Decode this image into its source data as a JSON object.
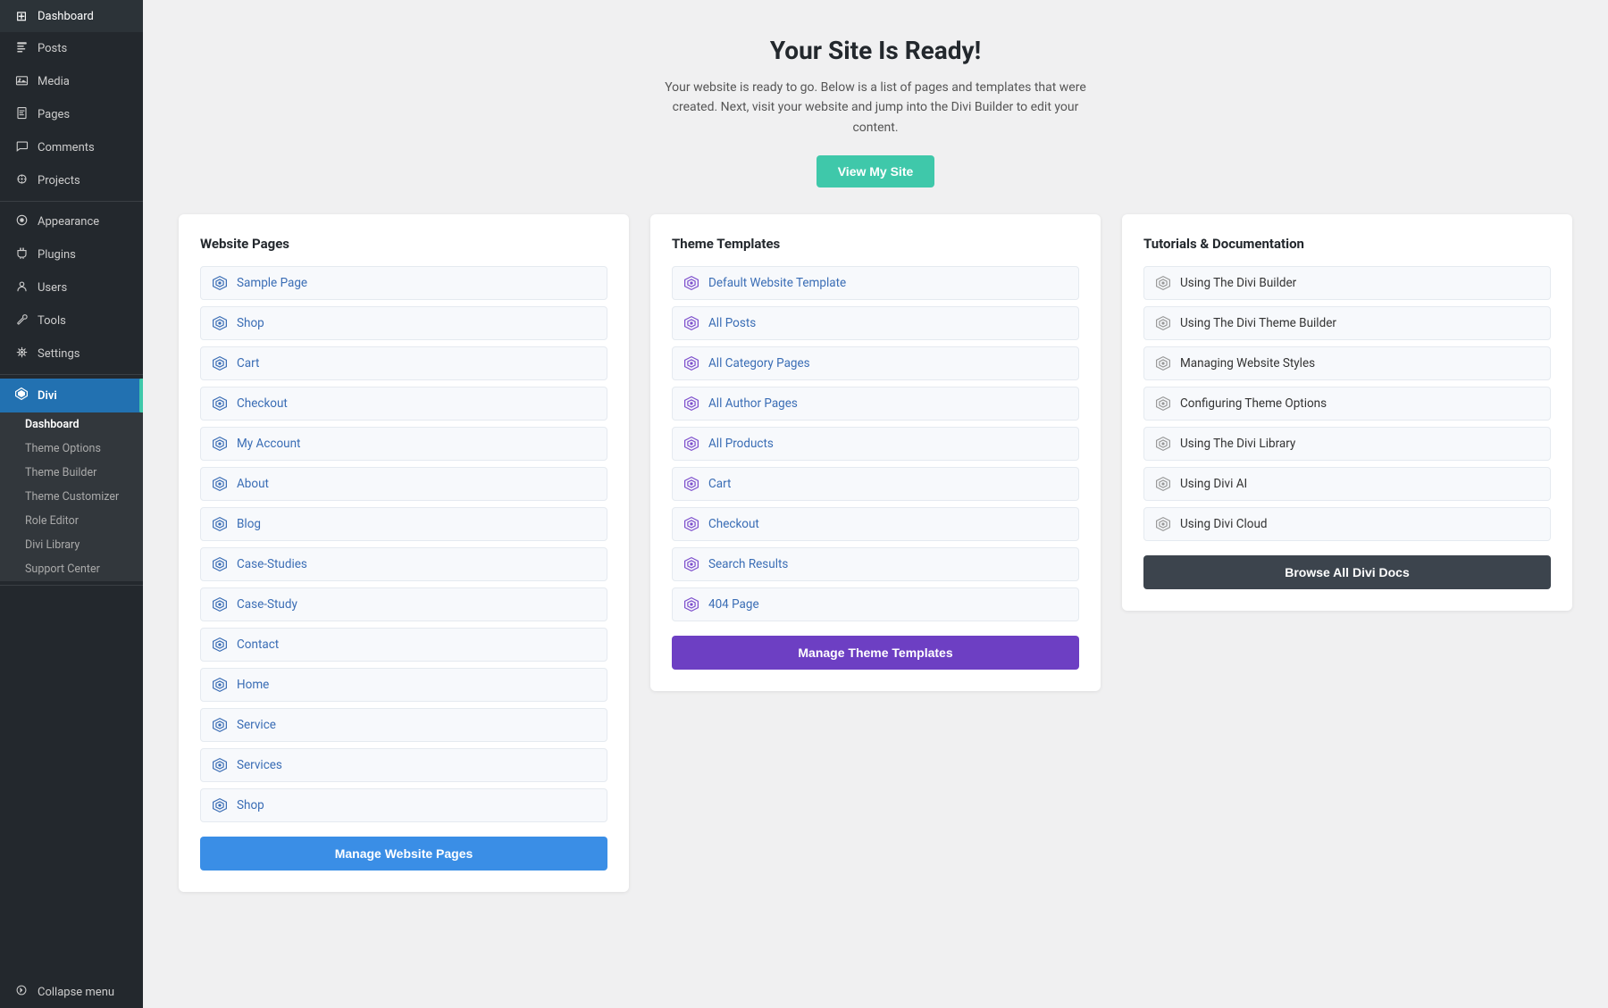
{
  "sidebar": {
    "items": [
      {
        "id": "dashboard",
        "label": "Dashboard",
        "icon": "⊞"
      },
      {
        "id": "posts",
        "label": "Posts",
        "icon": "📄"
      },
      {
        "id": "media",
        "label": "Media",
        "icon": "🖼"
      },
      {
        "id": "pages",
        "label": "Pages",
        "icon": "📋"
      },
      {
        "id": "comments",
        "label": "Comments",
        "icon": "💬"
      },
      {
        "id": "projects",
        "label": "Projects",
        "icon": "📌"
      },
      {
        "id": "appearance",
        "label": "Appearance",
        "icon": "🎨"
      },
      {
        "id": "plugins",
        "label": "Plugins",
        "icon": "🔌"
      },
      {
        "id": "users",
        "label": "Users",
        "icon": "👤"
      },
      {
        "id": "tools",
        "label": "Tools",
        "icon": "🔧"
      },
      {
        "id": "settings",
        "label": "Settings",
        "icon": "⚙"
      }
    ],
    "divi_label": "Divi",
    "divi_sub": [
      {
        "id": "dashboard-sub",
        "label": "Dashboard"
      },
      {
        "id": "theme-options",
        "label": "Theme Options"
      },
      {
        "id": "theme-builder",
        "label": "Theme Builder"
      },
      {
        "id": "theme-customizer",
        "label": "Theme Customizer"
      },
      {
        "id": "role-editor",
        "label": "Role Editor"
      },
      {
        "id": "divi-library",
        "label": "Divi Library"
      },
      {
        "id": "support-center",
        "label": "Support Center"
      }
    ],
    "collapse_label": "Collapse menu"
  },
  "header": {
    "title": "Your Site Is Ready!",
    "description": "Your website is ready to go. Below is a list of pages and templates that were created. Next, visit your website and jump into the Divi Builder to edit your content.",
    "view_site_label": "View My Site"
  },
  "website_pages": {
    "heading": "Website Pages",
    "items": [
      "Sample Page",
      "Shop",
      "Cart",
      "Checkout",
      "My Account",
      "About",
      "Blog",
      "Case-Studies",
      "Case-Study",
      "Contact",
      "Home",
      "Service",
      "Services",
      "Shop"
    ],
    "manage_label": "Manage Website Pages"
  },
  "theme_templates": {
    "heading": "Theme Templates",
    "items": [
      "Default Website Template",
      "All Posts",
      "All Category Pages",
      "All Author Pages",
      "All Products",
      "Cart",
      "Checkout",
      "Search Results",
      "404 Page"
    ],
    "manage_label": "Manage Theme Templates"
  },
  "tutorials": {
    "heading": "Tutorials & Documentation",
    "items": [
      "Using The Divi Builder",
      "Using The Divi Theme Builder",
      "Managing Website Styles",
      "Configuring Theme Options",
      "Using The Divi Library",
      "Using Divi AI",
      "Using Divi Cloud"
    ],
    "browse_label": "Browse All Divi Docs"
  },
  "colors": {
    "teal": "#3fc8aa",
    "blue_link": "#3a6db5",
    "blue_btn": "#3a8ee6",
    "purple_btn": "#6d3fc3",
    "dark_btn": "#3c444d",
    "sidebar_active": "#0073aa",
    "sidebar_bg": "#23282d",
    "sidebar_sub_bg": "#32373c",
    "divi_active": "#2271b1"
  }
}
